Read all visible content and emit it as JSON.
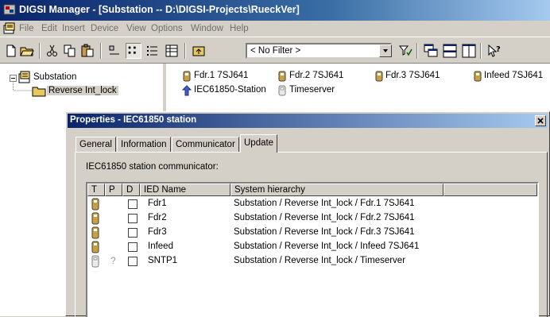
{
  "window": {
    "title": "DIGSI Manager - [Substation -- D:\\DIGSI-Projects\\RueckVer]"
  },
  "menu": {
    "items": [
      "File",
      "Edit",
      "Insert",
      "Device",
      "View",
      "Options",
      "Window",
      "Help"
    ]
  },
  "toolbar": {
    "filter_value": "< No Filter >",
    "buttons": [
      "new-icon",
      "open-icon",
      "cut-icon",
      "copy-icon",
      "paste-icon",
      "large-icons-icon",
      "small-icons-icon",
      "list-icon",
      "details-icon",
      "up-folder-icon",
      "filter-icon",
      "window-cascade-icon",
      "window-tile-icon",
      "window-split-icon",
      "help-context-icon"
    ]
  },
  "tree": {
    "root": "Substation",
    "child": "Reverse Int_lock"
  },
  "objects": {
    "row1": [
      "Fdr.1 7SJ641",
      "Fdr.2 7SJ641",
      "Fdr.3 7SJ641",
      "Infeed 7SJ641"
    ],
    "row2": [
      "IEC61850-Station",
      "Timeserver"
    ]
  },
  "dialog": {
    "title": "Properties - IEC61850 station",
    "tabs": [
      "General",
      "Information",
      "Communicator",
      "Update"
    ],
    "active_tab": "Update",
    "label": "IEC61850 station communicator:",
    "columns": [
      "T",
      "P",
      "D",
      "IED Name",
      "System hierarchy"
    ],
    "rows": [
      {
        "p": "",
        "ied": "Fdr1",
        "path": "Substation / Reverse Int_lock / Fdr.1 7SJ641"
      },
      {
        "p": "",
        "ied": "Fdr2",
        "path": "Substation / Reverse Int_lock / Fdr.2 7SJ641"
      },
      {
        "p": "",
        "ied": "Fdr3",
        "path": "Substation / Reverse Int_lock / Fdr.3 7SJ641"
      },
      {
        "p": "",
        "ied": "Infeed",
        "path": "Substation / Reverse Int_lock / Infeed 7SJ641"
      },
      {
        "p": "?",
        "ied": "SNTP1",
        "path": "Substation / Reverse Int_lock / Timeserver"
      }
    ]
  }
}
